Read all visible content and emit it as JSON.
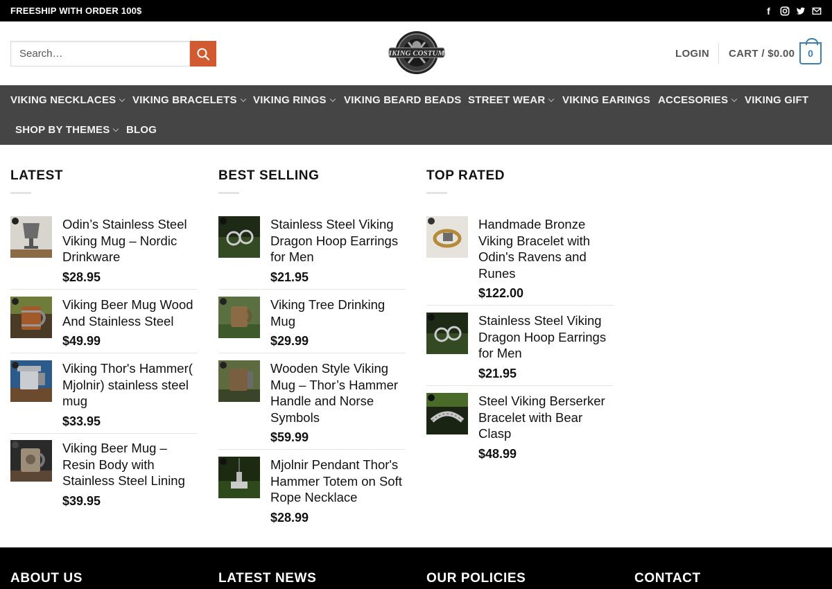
{
  "topbar": {
    "promo": "FREESHIP WITH ORDER 100$",
    "social_icons": [
      "facebook-icon",
      "instagram-icon",
      "twitter-icon",
      "email-icon"
    ]
  },
  "header": {
    "search_placeholder": "Search…",
    "logo_text": "VIKING COSTUME",
    "login": "LOGIN",
    "cart_label": "CART / $0.00",
    "cart_count": "0"
  },
  "nav": {
    "items": [
      {
        "label": "VIKING NECKLACES",
        "has_dropdown": true
      },
      {
        "label": "VIKING BRACELETS",
        "has_dropdown": true
      },
      {
        "label": "VIKING RINGS",
        "has_dropdown": true
      },
      {
        "label": "VIKING BEARD BEADS",
        "has_dropdown": false
      },
      {
        "label": "STREET WEAR",
        "has_dropdown": true
      },
      {
        "label": "VIKING EARINGS",
        "has_dropdown": false
      },
      {
        "label": "ACCESORIES",
        "has_dropdown": true
      },
      {
        "label": "VIKING GIFT",
        "has_dropdown": false
      },
      {
        "label": "SHOP BY THEMES",
        "has_dropdown": true
      },
      {
        "label": "BLOG",
        "has_dropdown": false
      }
    ]
  },
  "latest": {
    "heading": "LATEST",
    "products": [
      {
        "title": "Odin’s Stainless Steel Viking Mug – Nordic Drinkware",
        "price": "$28.95"
      },
      {
        "title": "Viking Beer Mug Wood And Stainless Steel",
        "price": "$49.99"
      },
      {
        "title": "Viking Thor's Hammer( Mjolnir) stainless steel mug",
        "price": "$33.95"
      },
      {
        "title": "Viking Beer Mug – Resin Body with Stainless Steel Lining",
        "price": "$39.95"
      }
    ]
  },
  "best_selling": {
    "heading": "BEST SELLING",
    "products": [
      {
        "title": "Stainless Steel Viking Dragon Hoop Earrings for Men",
        "price": "$21.95"
      },
      {
        "title": "Viking Tree Drinking Mug",
        "price": "$29.99"
      },
      {
        "title": "Wooden Style Viking Mug – Thor’s Hammer Handle and Norse Symbols",
        "price": "$59.99"
      },
      {
        "title": "Mjolnir Pendant Thor's Hammer Totem on Soft Rope Necklace",
        "price": "$28.99"
      }
    ]
  },
  "top_rated": {
    "heading": "TOP RATED",
    "products": [
      {
        "title": "Handmade Bronze Viking Bracelet with Odin's Ravens and Runes",
        "price": "$122.00"
      },
      {
        "title": "Stainless Steel Viking Dragon Hoop Earrings for Men",
        "price": "$21.95"
      },
      {
        "title": "Steel Viking Berserker Bracelet with Bear Clasp",
        "price": "$48.99"
      }
    ]
  },
  "footer": {
    "headings": [
      "ABOUT US",
      "LATEST NEWS",
      "OUR POLICIES",
      "CONTACT"
    ]
  },
  "colors": {
    "topbar_bg": "#000000",
    "nav_bg": "#454545",
    "search_button": "#d25a31",
    "cart_accent": "#3b7fb2"
  }
}
